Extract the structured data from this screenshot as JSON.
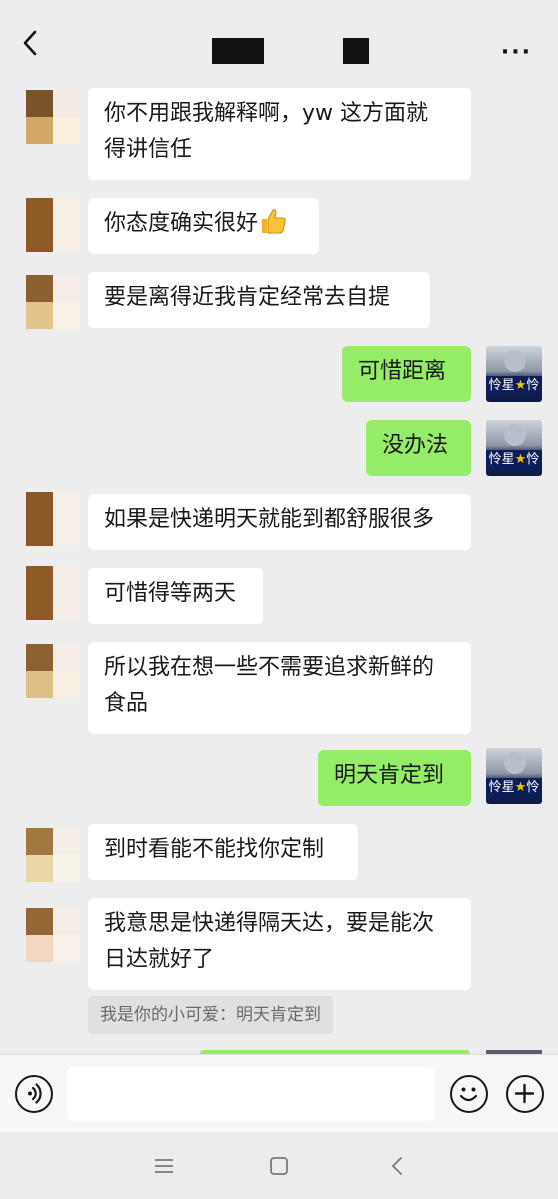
{
  "header": {
    "back_icon": "chevron-left-icon",
    "title_redacted": true,
    "more_icon": "more-dots-icon",
    "more_label": "···"
  },
  "messages": [
    {
      "side": "in",
      "text_lines": [
        "你不用跟我解释啊，yw 这方面就",
        "得讲信任"
      ]
    },
    {
      "side": "in",
      "text": "你态度确实很好",
      "emoji": "thumbs-up-icon"
    },
    {
      "side": "in",
      "text": "要是离得近我肯定经常去自提"
    },
    {
      "side": "out",
      "text": "可惜距离"
    },
    {
      "side": "out",
      "text": "没办法"
    },
    {
      "side": "in",
      "text": "如果是快递明天就能到都舒服很多"
    },
    {
      "side": "in",
      "text": "可惜得等两天"
    },
    {
      "side": "in",
      "text_lines": [
        "所以我在想一些不需要追求新鲜的",
        "食品"
      ]
    },
    {
      "side": "out",
      "text": "明天肯定到"
    },
    {
      "side": "in",
      "text": "到时看能不能找你定制"
    },
    {
      "side": "in",
      "text_lines": [
        "我意思是快递得隔天达，要是能次",
        "日达就好了"
      ]
    }
  ],
  "quote": {
    "text": "我是你的小可爱：明天肯定到"
  },
  "avatar_right": {
    "badge_text_a": "怜星",
    "badge_star": "★",
    "badge_text_b": "怜"
  },
  "input_bar": {
    "voice_icon": "voice-icon",
    "emoji_icon": "emoji-smile-icon",
    "add_icon": "plus-circle-icon",
    "input_value": "",
    "input_placeholder": ""
  },
  "system_nav": {
    "menu_icon": "menu-lines-icon",
    "home_icon": "home-square-icon",
    "back_icon": "nav-back-icon"
  },
  "colors": {
    "background": "#ededed",
    "bubble_in": "#ffffff",
    "bubble_out": "#95ec69",
    "quote_bg": "#e0e0e0"
  }
}
